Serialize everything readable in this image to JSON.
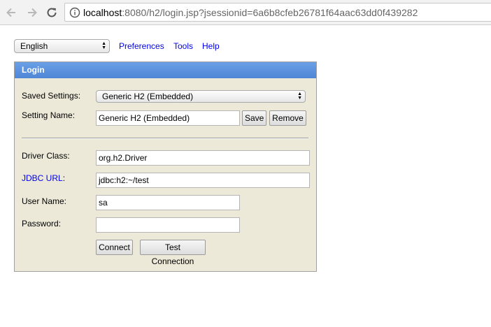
{
  "browser": {
    "url_host": "localhost",
    "url_rest": ":8080/h2/login.jsp?jsessionid=6a6b8cfeb26781f64aac63dd0f439282"
  },
  "top": {
    "language": "English",
    "links": [
      "Preferences",
      "Tools",
      "Help"
    ]
  },
  "login": {
    "title": "Login",
    "saved_settings_label": "Saved Settings:",
    "saved_settings_value": "Generic H2 (Embedded)",
    "setting_name_label": "Setting Name:",
    "setting_name_value": "Generic H2 (Embedded)",
    "save_label": "Save",
    "remove_label": "Remove",
    "driver_class_label": "Driver Class:",
    "driver_class_value": "org.h2.Driver",
    "jdbc_url_label": "JDBC URL",
    "jdbc_url_colon": ":",
    "jdbc_url_value": "jdbc:h2:~/test",
    "user_name_label": "User Name:",
    "user_name_value": "sa",
    "password_label": "Password:",
    "password_value": "",
    "connect_label": "Connect",
    "test_connection_label": "Test Connection"
  }
}
